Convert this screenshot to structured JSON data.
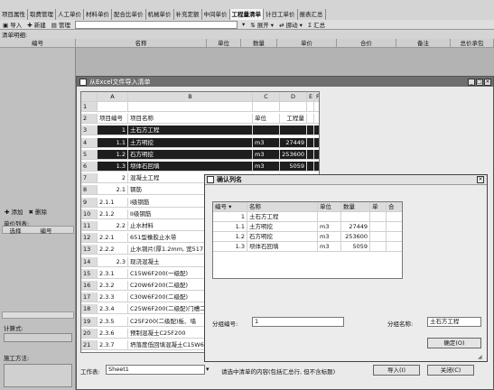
{
  "tabs": [
    "项目属性",
    "取费管理",
    "人工单价",
    "材料单价",
    "配合比单价",
    "机械单价",
    "补充定额",
    "中间单价",
    "工程量清单",
    "计日工单价",
    "报表汇总"
  ],
  "active_tab_index": 8,
  "toolbar": {
    "import": "导入",
    "new": "新建",
    "manage": "管理",
    "expand": "展开",
    "move": "挪动",
    "summary": "汇总"
  },
  "bill_label": "清单明细:",
  "main_header": {
    "code": "编号",
    "name": "名称",
    "unit": "单位",
    "qty": "数量",
    "price": "单价",
    "total": "合价",
    "remark": "备注",
    "package": "总价承包"
  },
  "left_panel": {
    "add": "添加",
    "delete": "删除",
    "unit_price_label": "单价列表:",
    "col_select": "选择",
    "col_code": "编号",
    "formula_label": "计算式:",
    "method_label": "施工方法:"
  },
  "excel_window": {
    "title": "从Excel文件导入清单",
    "sheet_label": "工作表:",
    "sheet_value": "Sheet1",
    "hint": "请选中清单的内容(包括汇总行, 但不含标题)",
    "import_button": "导入(I)",
    "close_button": "关闭(C)",
    "col_headers": [
      "A",
      "B",
      "C",
      "D",
      "E",
      "F"
    ],
    "rows": [
      {
        "n": "1",
        "a": "",
        "b": "",
        "c": "",
        "d": "",
        "sel": false
      },
      {
        "n": "2",
        "a": "项目编号",
        "b": "项目名称",
        "c": "单位",
        "d": "工程量",
        "sel": false
      },
      {
        "n": "3",
        "a": "1",
        "b": "土石方工程",
        "c": "",
        "d": "",
        "sel": true
      },
      {
        "n": "4",
        "a": "1.1",
        "b": "土方明挖",
        "c": "m3",
        "d": "27449",
        "sel": true
      },
      {
        "n": "5",
        "a": "1.2",
        "b": "石方明挖",
        "c": "m3",
        "d": "253600",
        "sel": true
      },
      {
        "n": "6",
        "a": "1.3",
        "b": "坝体石回填",
        "c": "m3",
        "d": "5059",
        "sel": true
      },
      {
        "n": "7",
        "a": "2",
        "b": "混凝土工程",
        "c": "",
        "d": "",
        "sel": false
      },
      {
        "n": "8",
        "a": "2.1",
        "b": "钢筋",
        "c": "",
        "d": "",
        "sel": false
      },
      {
        "n": "9",
        "a": "2.1.1",
        "b": "I级钢筋",
        "c": "",
        "d": "",
        "sel": false
      },
      {
        "n": "10",
        "a": "2.1.2",
        "b": "II级钢筋",
        "c": "",
        "d": "",
        "sel": false
      },
      {
        "n": "11",
        "a": "2.2",
        "b": "止水材料",
        "c": "",
        "d": "",
        "sel": false
      },
      {
        "n": "12",
        "a": "2.2.1",
        "b": "651型橡胶止水带",
        "c": "",
        "d": "",
        "sel": false
      },
      {
        "n": "13",
        "a": "2.2.2",
        "b": "止水铜片(厚1.2mm, 宽517",
        "c": "",
        "d": "",
        "sel": false
      },
      {
        "n": "14",
        "a": "2.3",
        "b": "现浇混凝土",
        "c": "",
        "d": "",
        "sel": false
      },
      {
        "n": "15",
        "a": "2.3.1",
        "b": "C15W6F200(一级配)",
        "c": "",
        "d": "",
        "sel": false
      },
      {
        "n": "16",
        "a": "2.3.2",
        "b": "C20W6F200(二级配)",
        "c": "",
        "d": "",
        "sel": false
      },
      {
        "n": "17",
        "a": "2.3.3",
        "b": "C30W6F200(二级配)",
        "c": "",
        "d": "",
        "sel": false
      },
      {
        "n": "18",
        "a": "2.3.4",
        "b": "C25W6F200(二级配)门槽二",
        "c": "",
        "d": "",
        "sel": false
      },
      {
        "n": "19",
        "a": "2.3.5",
        "b": "C25F200(二级配)板、墙",
        "c": "",
        "d": "",
        "sel": false
      },
      {
        "n": "20",
        "a": "2.3.6",
        "b": "预制混凝土C25F200",
        "c": "",
        "d": "",
        "sel": false
      },
      {
        "n": "21",
        "a": "2.3.7",
        "b": "坍落度低回填混凝土C15W6",
        "c": "",
        "d": "",
        "sel": false
      }
    ]
  },
  "confirm_dialog": {
    "title": "确认列名",
    "headers": [
      "编号",
      "名称",
      "单位",
      "数量",
      "单",
      "合"
    ],
    "rows": [
      {
        "code": "1",
        "name": "土石方工程",
        "unit": "",
        "qty": ""
      },
      {
        "code": "1.1",
        "name": "土方明挖",
        "unit": "m3",
        "qty": "27449"
      },
      {
        "code": "1.2",
        "name": "石方明挖",
        "unit": "m3",
        "qty": "253600"
      },
      {
        "code": "1.3",
        "name": "坝体石回填",
        "unit": "m3",
        "qty": "5059"
      }
    ],
    "group_code_label": "分组编号:",
    "group_code_value": "1",
    "group_name_label": "分组名称:",
    "group_name_value": "土石方工程",
    "ok_button": "确定(O)"
  }
}
